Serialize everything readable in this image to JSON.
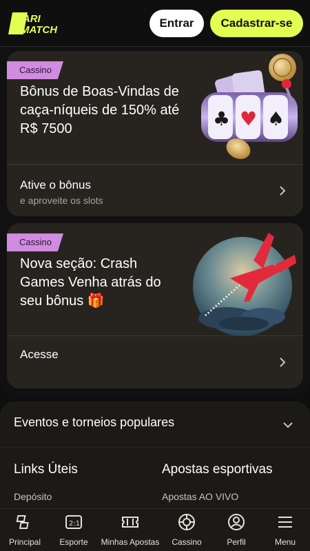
{
  "header": {
    "logo_text": "PARIMATCH",
    "login_label": "Entrar",
    "register_label": "Cadastrar-se",
    "brand_color": "#e3fd51"
  },
  "promos": [
    {
      "tag": "Cassino",
      "title": "Bônus de Boas-Vindas de caça-níqueis de 150% até R$ 7500",
      "action_title": "Ative o bônus",
      "action_subtitle": "e aproveite os slots",
      "art_icon": "slot-machine-icon"
    },
    {
      "tag": "Cassino",
      "title": "Nova seção: Crash Games Venha atrás do seu bônus 🎁",
      "action_title": "Acesse",
      "art_icon": "airplane-crash-icon"
    }
  ],
  "events": {
    "title": "Eventos e torneios populares"
  },
  "footer_links": {
    "left_title": "Links Úteis",
    "left_first": "Depósito",
    "right_title": "Apostas esportivas",
    "right_first": "Apostas AO VIVO"
  },
  "bottom_nav": [
    {
      "label": "Principal",
      "icon": "home-icon"
    },
    {
      "label": "Esporte",
      "icon": "scoreboard-icon"
    },
    {
      "label": "Minhas Apostas",
      "icon": "ticket-icon"
    },
    {
      "label": "Cassino",
      "icon": "roulette-icon"
    },
    {
      "label": "Perfil",
      "icon": "user-icon"
    },
    {
      "label": "Menu",
      "icon": "menu-icon"
    }
  ]
}
